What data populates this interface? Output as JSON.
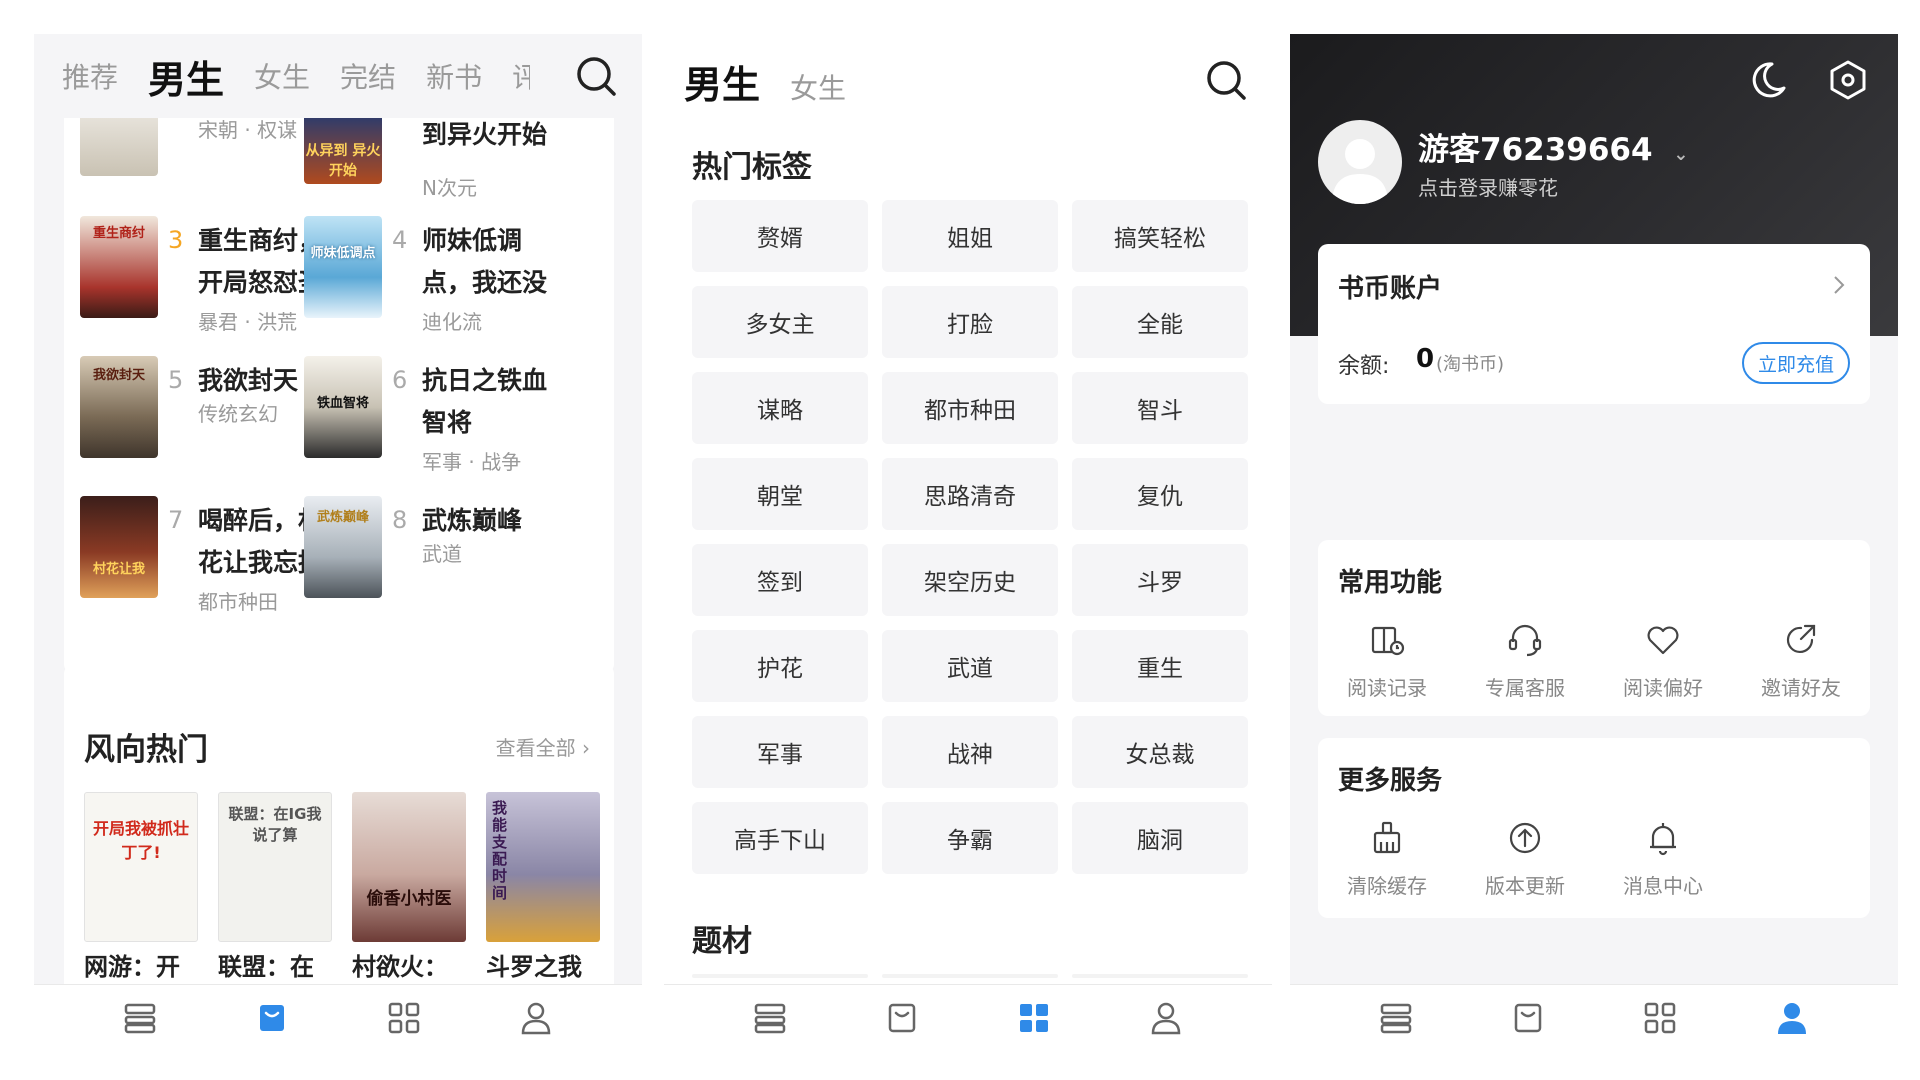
{
  "panel1": {
    "top_tabs": [
      {
        "label": "推荐",
        "active": false
      },
      {
        "label": "男生",
        "active": true
      },
      {
        "label": "女生",
        "active": false
      },
      {
        "label": "完结",
        "active": false
      },
      {
        "label": "新书",
        "active": false
      },
      {
        "label": "评",
        "active": false
      }
    ],
    "rank_partial": [
      {
        "tag": "宋朝 · 权谋"
      },
      {
        "title": "到异火开始",
        "tag": "N次元",
        "cover_text": "从异到 异火开始"
      }
    ],
    "rank_items": [
      {
        "rank": "3",
        "title": "重生商纣，开局怒怼圣",
        "tag": "暴君 · 洪荒",
        "cover_text": "重生商纣"
      },
      {
        "rank": "4",
        "title": "师妹低调点，我还没",
        "tag": "迪化流",
        "cover_text": "师妹低调点"
      },
      {
        "rank": "5",
        "title": "我欲封天",
        "tag": "传统玄幻",
        "cover_text": "我欲封天"
      },
      {
        "rank": "6",
        "title": "抗日之铁血智将",
        "tag": "军事 · 战争",
        "cover_text": "铁血智将"
      },
      {
        "rank": "7",
        "title": "喝醉后，村花让我忘掉",
        "tag": "都市种田",
        "cover_text": "村花让我"
      },
      {
        "rank": "8",
        "title": "武炼巅峰",
        "tag": "武道",
        "cover_text": "武炼巅峰"
      }
    ],
    "hot_section": {
      "title": "风向热门",
      "more": "查看全部",
      "books": [
        {
          "name": "网游：开局我被抓",
          "cover_text": "开局我被抓壮丁了!"
        },
        {
          "name": "联盟：在IG，我说",
          "cover_text": "联盟：在IG我说了算"
        },
        {
          "name": "村欲火：尤物寡嫂",
          "cover_text": "偷香小村医"
        },
        {
          "name": "斗罗之我能支配时",
          "cover_text": "我能支配时间"
        }
      ]
    }
  },
  "panel2": {
    "tabs": [
      {
        "label": "男生",
        "active": true
      },
      {
        "label": "女生",
        "active": false
      }
    ],
    "hot_tags_title": "热门标签",
    "tags": [
      "赘婿",
      "姐姐",
      "搞笑轻松",
      "多女主",
      "打脸",
      "全能",
      "谋略",
      "都市种田",
      "智斗",
      "朝堂",
      "思路清奇",
      "复仇",
      "签到",
      "架空历史",
      "斗罗",
      "护花",
      "武道",
      "重生",
      "军事",
      "战神",
      "女总裁",
      "高手下山",
      "争霸",
      "脑洞"
    ],
    "topics_title": "题材"
  },
  "panel3": {
    "username": "游客76239664",
    "login_tip": "点击登录赚零花",
    "account_card": {
      "title": "书币账户",
      "balance_label": "余额:",
      "balance_value": "0",
      "balance_unit": "(淘书币)",
      "recharge": "立即充值"
    },
    "common_title": "常用功能",
    "common": [
      {
        "label": "阅读记录",
        "icon": "history-icon"
      },
      {
        "label": "专属客服",
        "icon": "headset-icon"
      },
      {
        "label": "阅读偏好",
        "icon": "heart-icon"
      },
      {
        "label": "邀请好友",
        "icon": "share-icon"
      }
    ],
    "more_title": "更多服务",
    "more": [
      {
        "label": "清除缓存",
        "icon": "broom-icon"
      },
      {
        "label": "版本更新",
        "icon": "upload-cloud-icon"
      },
      {
        "label": "消息中心",
        "icon": "bell-icon"
      }
    ]
  },
  "bottom_nav": [
    {
      "icon": "bookshelf-icon"
    },
    {
      "icon": "store-icon"
    },
    {
      "icon": "category-icon"
    },
    {
      "icon": "profile-icon"
    }
  ],
  "colors": {
    "accent": "#2f8ae8",
    "inactive": "#9a9a9a",
    "rank_top": "#f5a623",
    "dark_header": "#2a2a2d"
  }
}
